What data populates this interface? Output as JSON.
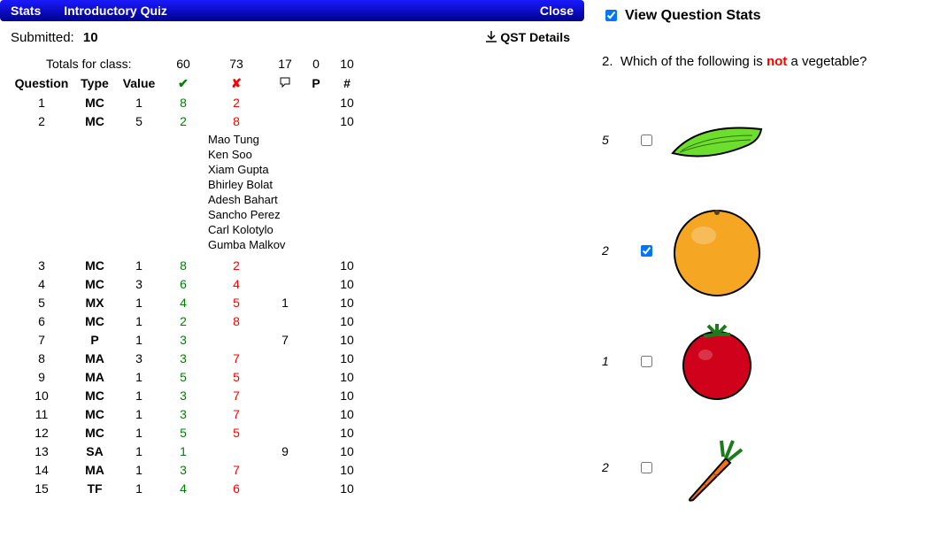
{
  "header": {
    "stats": "Stats",
    "title": "Introductory Quiz",
    "close": "Close"
  },
  "submitted": {
    "label": "Submitted:",
    "value": "10"
  },
  "qst_details": "QST Details",
  "totals_label": "Totals for class:",
  "totals": {
    "correct": "60",
    "wrong": "73",
    "hint": "17",
    "partial": "0",
    "count": "10"
  },
  "columns": {
    "q": "Question",
    "type": "Type",
    "val": "Value",
    "check": "✔",
    "cross": "✘",
    "hint": "💬",
    "p": "P",
    "num": "#"
  },
  "rows": [
    {
      "q": "1",
      "type": "MC",
      "val": "1",
      "c": "8",
      "w": "2",
      "h": "",
      "p": "",
      "n": "10",
      "names": []
    },
    {
      "q": "2",
      "type": "MC",
      "val": "5",
      "c": "2",
      "w": "8",
      "h": "",
      "p": "",
      "n": "10",
      "names": [
        "Mao Tung",
        "Ken Soo",
        "Xiam Gupta",
        "Bhirley Bolat",
        "Adesh Bahart",
        "Sancho Perez",
        "Carl Kolotylo",
        "Gumba Malkov"
      ]
    },
    {
      "q": "3",
      "type": "MC",
      "val": "1",
      "c": "8",
      "w": "2",
      "h": "",
      "p": "",
      "n": "10",
      "names": []
    },
    {
      "q": "4",
      "type": "MC",
      "val": "3",
      "c": "6",
      "w": "4",
      "h": "",
      "p": "",
      "n": "10",
      "names": []
    },
    {
      "q": "5",
      "type": "MX",
      "val": "1",
      "c": "4",
      "w": "5",
      "h": "1",
      "p": "",
      "n": "10",
      "names": []
    },
    {
      "q": "6",
      "type": "MC",
      "val": "1",
      "c": "2",
      "w": "8",
      "h": "",
      "p": "",
      "n": "10",
      "names": []
    },
    {
      "q": "7",
      "type": "P",
      "val": "1",
      "c": "3",
      "w": "",
      "h": "7",
      "p": "",
      "n": "10",
      "names": []
    },
    {
      "q": "8",
      "type": "MA",
      "val": "3",
      "c": "3",
      "w": "7",
      "h": "",
      "p": "",
      "n": "10",
      "names": []
    },
    {
      "q": "9",
      "type": "MA",
      "val": "1",
      "c": "5",
      "w": "5",
      "h": "",
      "p": "",
      "n": "10",
      "names": []
    },
    {
      "q": "10",
      "type": "MC",
      "val": "1",
      "c": "3",
      "w": "7",
      "h": "",
      "p": "",
      "n": "10",
      "names": []
    },
    {
      "q": "11",
      "type": "MC",
      "val": "1",
      "c": "3",
      "w": "7",
      "h": "",
      "p": "",
      "n": "10",
      "names": []
    },
    {
      "q": "12",
      "type": "MC",
      "val": "1",
      "c": "5",
      "w": "5",
      "h": "",
      "p": "",
      "n": "10",
      "names": []
    },
    {
      "q": "13",
      "type": "SA",
      "val": "1",
      "c": "1",
      "w": "",
      "h": "9",
      "p": "",
      "n": "10",
      "names": []
    },
    {
      "q": "14",
      "type": "MA",
      "val": "1",
      "c": "3",
      "w": "7",
      "h": "",
      "p": "",
      "n": "10",
      "names": []
    },
    {
      "q": "15",
      "type": "TF",
      "val": "1",
      "c": "4",
      "w": "6",
      "h": "",
      "p": "",
      "n": "10",
      "names": []
    }
  ],
  "right": {
    "title": "View Question Stats",
    "q_num": "2.",
    "q_text_pre": "Which of the following is ",
    "q_text_not": "not",
    "q_text_post": " a vegetable?",
    "answers": [
      {
        "count": "5",
        "checked": false,
        "icon": "cucumber"
      },
      {
        "count": "2",
        "checked": true,
        "icon": "orange"
      },
      {
        "count": "1",
        "checked": false,
        "icon": "tomato"
      },
      {
        "count": "2",
        "checked": false,
        "icon": "carrot"
      }
    ]
  }
}
